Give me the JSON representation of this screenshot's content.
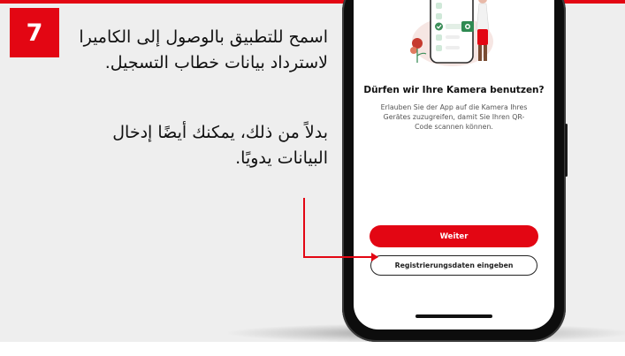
{
  "step": {
    "number": "7"
  },
  "instructions": {
    "line1": "اسمح للتطبيق بالوصول إلى الكاميرا لاسترداد بيانات خطاب التسجيل.",
    "line2": "بدلاً من ذلك، يمكنك أيضًا إدخال البيانات يدويًا."
  },
  "phone_screen": {
    "title": "Dürfen wir Ihre Kamera benutzen?",
    "description": "Erlauben Sie der App auf die Kamera Ihres Gerätes zuzugreifen, damit Sie Ihren QR-Code scannen können.",
    "primary_button": "Weiter",
    "secondary_button": "Registrierungsdaten eingeben"
  },
  "colors": {
    "accent": "#e30613",
    "panel_background": "#eeeeee",
    "phone_frame": "#0d0d0d"
  },
  "icons": [
    "smartphone-illustration",
    "checkmark-icon",
    "camera-icon",
    "pointer-line"
  ]
}
